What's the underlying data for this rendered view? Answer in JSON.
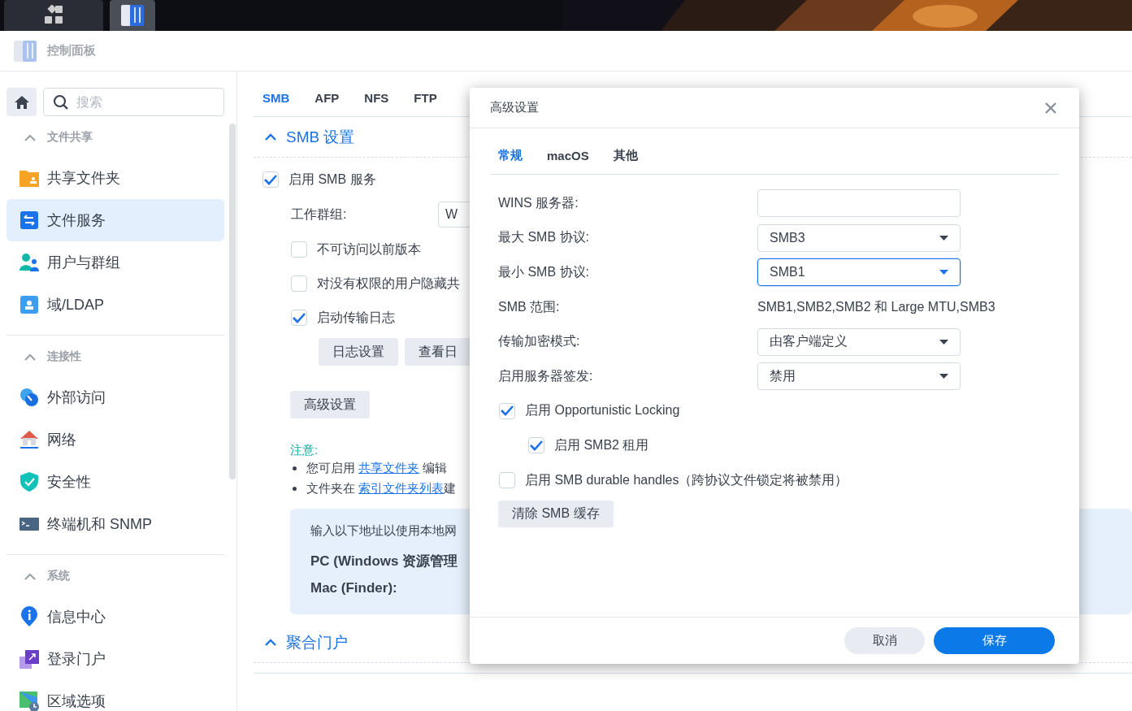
{
  "taskbar": {
    "buttons": [
      {
        "selected": false
      },
      {
        "selected": true
      }
    ]
  },
  "app_header": {
    "title": "控制面板"
  },
  "sidebar": {
    "search": {
      "placeholder": "搜索"
    },
    "sections": [
      {
        "title": "文件共享",
        "expanded": true,
        "items": [
          {
            "label": "共享文件夹",
            "selected": false
          },
          {
            "label": "文件服务",
            "selected": true
          },
          {
            "label": "用户与群组",
            "selected": false
          },
          {
            "label": "域/LDAP",
            "selected": false
          }
        ]
      },
      {
        "title": "连接性",
        "expanded": true,
        "items": [
          {
            "label": "外部访问",
            "selected": false
          },
          {
            "label": "网络",
            "selected": false
          },
          {
            "label": "安全性",
            "selected": false
          },
          {
            "label": "终端机和 SNMP",
            "selected": false
          }
        ]
      },
      {
        "title": "系统",
        "expanded": true,
        "items": [
          {
            "label": "信息中心",
            "selected": false
          },
          {
            "label": "登录门户",
            "selected": false
          },
          {
            "label": "区域选项",
            "selected": false
          }
        ]
      }
    ]
  },
  "main": {
    "tabs": [
      {
        "label": "SMB",
        "selected": true
      },
      {
        "label": "AFP",
        "selected": false
      },
      {
        "label": "NFS",
        "selected": false
      },
      {
        "label": "FTP",
        "selected": false
      }
    ],
    "smb_section": {
      "title": "SMB 设置",
      "expanded": true
    },
    "enable_smb": {
      "label": "启用 SMB 服务",
      "checked": true
    },
    "workgroup": {
      "label": "工作群组:",
      "value": "W"
    },
    "options": [
      {
        "label": "不可访问以前版本",
        "checked": false
      },
      {
        "label": "对没有权限的用户隐藏共",
        "checked": false
      },
      {
        "label": "启动传输日志",
        "checked": true
      }
    ],
    "log_buttons": [
      "日志设置",
      "查看日"
    ],
    "advanced_button": "高级设置",
    "note": {
      "title": "注意:",
      "bullets": [
        {
          "before": "您可启用 ",
          "link": "共享文件夹",
          "after": " 编辑"
        },
        {
          "before": "文件夹在 ",
          "link": "索引文件夹列表",
          "after": "建"
        }
      ]
    },
    "info_box": {
      "lines": [
        {
          "text": "输入以下地址以使用本地网",
          "kind": "plain"
        },
        {
          "text": "PC (Windows 资源管理",
          "kind": "bold"
        },
        {
          "text": "Mac (Finder):",
          "kind": "bold"
        }
      ]
    },
    "portal_section": {
      "title": "聚合门户",
      "expanded": true
    }
  },
  "dialog": {
    "title": "高级设置",
    "tabs": [
      {
        "label": "常规",
        "selected": true
      },
      {
        "label": "macOS",
        "selected": false
      },
      {
        "label": "其他",
        "selected": false
      }
    ],
    "fields": [
      {
        "label": "WINS 服务器:",
        "kind": "input",
        "focused": false
      },
      {
        "label": "最大 SMB 协议:",
        "kind": "select",
        "value": "SMB3",
        "focused": false
      },
      {
        "label": "最小 SMB 协议:",
        "kind": "select",
        "value": "SMB1",
        "focused": true
      },
      {
        "label": "SMB 范围:",
        "kind": "text",
        "value": "SMB1,SMB2,SMB2 和 Large MTU,SMB3"
      },
      {
        "label": "传输加密模式:",
        "kind": "select",
        "value": "由客户端定义",
        "focused": false
      },
      {
        "label": "启用服务器签发:",
        "kind": "select",
        "value": "禁用",
        "focused": false
      }
    ],
    "options": [
      {
        "label": "启用 Opportunistic Locking",
        "checked": true,
        "children": [
          {
            "label": "启用 SMB2 租用",
            "checked": true
          }
        ]
      },
      {
        "label": "启用 SMB durable handles（跨协议文件锁定将被禁用）",
        "checked": false
      }
    ],
    "clear_button": "清除 SMB 缓存",
    "footer_buttons": [
      {
        "label": "取消",
        "kind": "secondary"
      },
      {
        "label": "保存",
        "kind": "primary"
      }
    ]
  }
}
